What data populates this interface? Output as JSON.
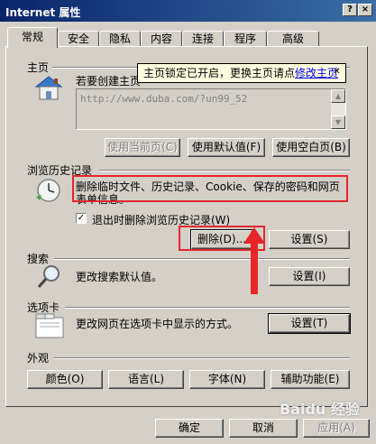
{
  "window": {
    "title": "Internet 属性",
    "help": "?",
    "close": "×"
  },
  "tabs": [
    "常规",
    "安全",
    "隐私",
    "内容",
    "连接",
    "程序",
    "高级"
  ],
  "home": {
    "label": "主页",
    "description": "若要创建主页",
    "url": "http://www.duba.com/?un99_52",
    "tooltip_text": "主页锁定已开启，更换主页请点",
    "tooltip_link": "修改主页",
    "btn_current": "使用当前页(C)",
    "btn_default": "使用默认值(F)",
    "btn_blank": "使用空白页(B)"
  },
  "history": {
    "label": "浏览历史记录",
    "description": "删除临时文件、历史记录、Cookie、保存的密码和网页表单信息。",
    "checkbox_label": "退出时删除浏览历史记录(W)",
    "btn_delete": "删除(D)...",
    "btn_settings": "设置(S)"
  },
  "search": {
    "label": "搜索",
    "description": "更改搜索默认值。",
    "btn_settings": "设置(I)"
  },
  "tabs_section": {
    "label": "选项卡",
    "description": "更改网页在选项卡中显示的方式。",
    "btn_settings": "设置(T)"
  },
  "appearance": {
    "label": "外观",
    "btn_colors": "颜色(O)",
    "btn_languages": "语言(L)",
    "btn_fonts": "字体(N)",
    "btn_accessibility": "辅助功能(E)"
  },
  "footer": {
    "ok": "确定",
    "cancel": "取消",
    "apply": "应用(A)"
  },
  "watermark": "Baidu 经验",
  "colors": {
    "annotation_red": "#e8262a",
    "titlebar": "#0a246a"
  }
}
